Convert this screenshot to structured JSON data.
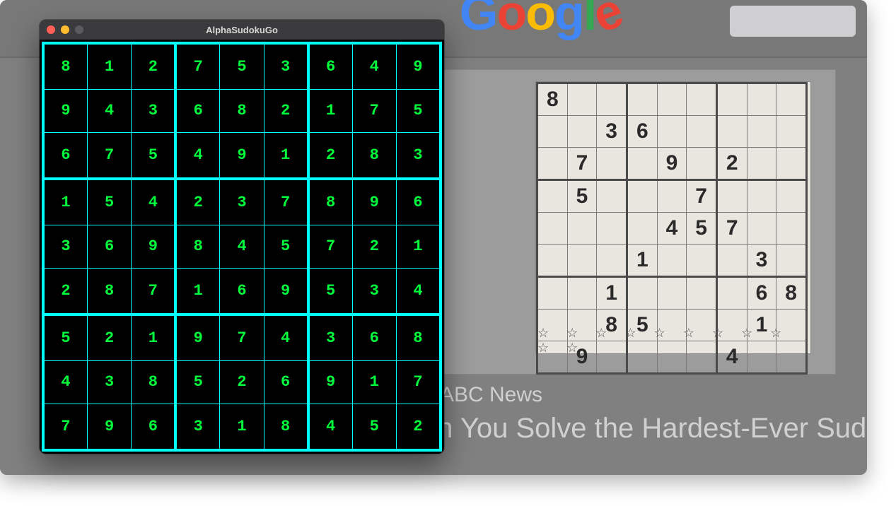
{
  "browser": {
    "logo_letters": [
      "G",
      "o",
      "o",
      "g",
      "l",
      "e"
    ],
    "caption": "ABC News",
    "headline": "an You Solve the Hardest-Ever Sudok",
    "stars": "☆ ☆ ☆ ☆ ☆ ☆ ☆ ☆ ☆ ☆ ☆",
    "puzzle": [
      [
        "8",
        "",
        "",
        "",
        "",
        "",
        "",
        "",
        ""
      ],
      [
        "",
        "",
        "3",
        "6",
        "",
        "",
        "",
        "",
        ""
      ],
      [
        "",
        "7",
        "",
        "",
        "9",
        "",
        "2",
        "",
        ""
      ],
      [
        "",
        "5",
        "",
        "",
        "",
        "7",
        "",
        "",
        ""
      ],
      [
        "",
        "",
        "",
        "",
        "4",
        "5",
        "7",
        "",
        ""
      ],
      [
        "",
        "",
        "",
        "1",
        "",
        "",
        "",
        "3",
        ""
      ],
      [
        "",
        "",
        "1",
        "",
        "",
        "",
        "",
        "6",
        "8"
      ],
      [
        "",
        "",
        "8",
        "5",
        "",
        "",
        "",
        "1",
        ""
      ],
      [
        "",
        "9",
        "",
        "",
        "",
        "",
        "4",
        "",
        ""
      ]
    ]
  },
  "app": {
    "title": "AlphaSudokuGo",
    "grid": [
      [
        "8",
        "1",
        "2",
        "7",
        "5",
        "3",
        "6",
        "4",
        "9"
      ],
      [
        "9",
        "4",
        "3",
        "6",
        "8",
        "2",
        "1",
        "7",
        "5"
      ],
      [
        "6",
        "7",
        "5",
        "4",
        "9",
        "1",
        "2",
        "8",
        "3"
      ],
      [
        "1",
        "5",
        "4",
        "2",
        "3",
        "7",
        "8",
        "9",
        "6"
      ],
      [
        "3",
        "6",
        "9",
        "8",
        "4",
        "5",
        "7",
        "2",
        "1"
      ],
      [
        "2",
        "8",
        "7",
        "1",
        "6",
        "9",
        "5",
        "3",
        "4"
      ],
      [
        "5",
        "2",
        "1",
        "9",
        "7",
        "4",
        "3",
        "6",
        "8"
      ],
      [
        "4",
        "3",
        "8",
        "5",
        "2",
        "6",
        "9",
        "1",
        "7"
      ],
      [
        "7",
        "9",
        "6",
        "3",
        "1",
        "8",
        "4",
        "5",
        "2"
      ]
    ]
  }
}
